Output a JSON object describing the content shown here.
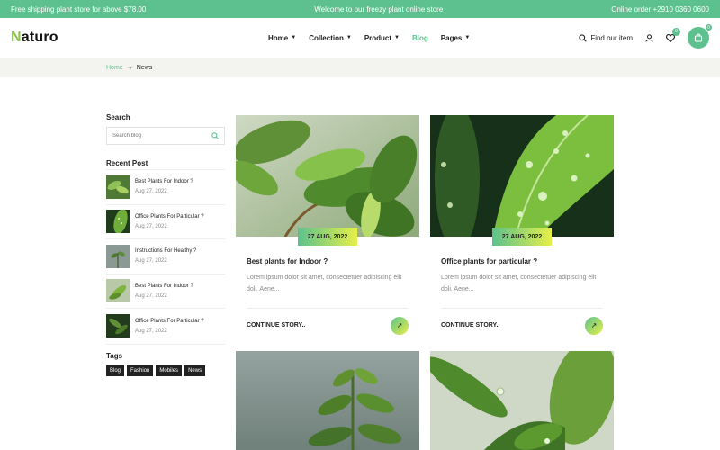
{
  "topbar": {
    "left": "Free shipping plant store for above $78.00",
    "center": "Welcome to our freezy plant online store",
    "right": "Online order +2910 0360 0600"
  },
  "header": {
    "logo_first": "N",
    "logo_rest": "aturo",
    "nav": [
      {
        "label": "Home",
        "has_dropdown": true
      },
      {
        "label": "Collection",
        "has_dropdown": true
      },
      {
        "label": "Product",
        "has_dropdown": true
      },
      {
        "label": "Blog",
        "has_dropdown": false,
        "active": true
      },
      {
        "label": "Pages",
        "has_dropdown": true
      }
    ],
    "find_label": "Find our item",
    "wishlist_count": "0",
    "cart_count": "0",
    "accent": "#5cc18e"
  },
  "breadcrumb": {
    "home": "Home",
    "current": "News"
  },
  "sidebar": {
    "search_title": "Search",
    "search_placeholder": "Search blog",
    "recent_title": "Recent Post",
    "posts": [
      {
        "title": "Best Plants For Indoor ?",
        "date": "Aug 27, 2022"
      },
      {
        "title": "Office Plants For Particular ?",
        "date": "Aug 27, 2022"
      },
      {
        "title": "Instructions For Healthy ?",
        "date": "Aug 27, 2022"
      },
      {
        "title": "Best Plants For Indoor ?",
        "date": "Aug 27, 2022"
      },
      {
        "title": "Office Plants For Particular ?",
        "date": "Aug 27, 2022"
      }
    ],
    "tags_title": "Tags",
    "tags": [
      "Blog",
      "Fashion",
      "Mobiles",
      "News"
    ]
  },
  "cards": [
    {
      "date": "27 AUG, 2022",
      "title": "Best plants for Indoor ?",
      "excerpt": "Lorem ipsum dolor sit amet, consectetuer adipiscing elit doli. Aene...",
      "more": "CONTINUE STORY.."
    },
    {
      "date": "27 AUG, 2022",
      "title": "Office plants for particular ?",
      "excerpt": "Lorem ipsum dolor sit amet, consectetuer adipiscing elit doli. Aene...",
      "more": "CONTINUE STORY.."
    }
  ]
}
